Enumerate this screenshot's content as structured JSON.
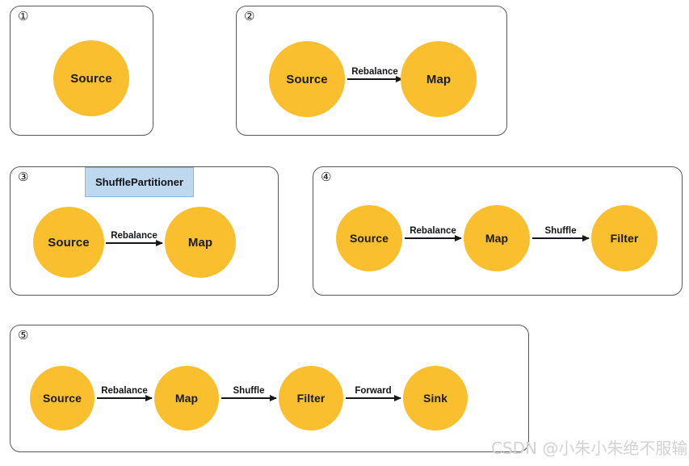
{
  "background_color": "#ffffff",
  "node_color": "#fabf2e",
  "panel_border_color": "#55595c",
  "edge_color": "#15171a",
  "callout_fill": "#bed8ef",
  "callout_border": "#8fb4d4",
  "watermark": "CSDN @小朱小朱绝不服输",
  "panels": [
    {
      "number": "①",
      "nodes": [
        {
          "label": "Source"
        }
      ],
      "edges": []
    },
    {
      "number": "②",
      "nodes": [
        {
          "label": "Source"
        },
        {
          "label": "Map"
        }
      ],
      "edges": [
        {
          "label": "Rebalance"
        }
      ]
    },
    {
      "number": "③",
      "callout": "ShufflePartitioner",
      "nodes": [
        {
          "label": "Source"
        },
        {
          "label": "Map"
        }
      ],
      "edges": [
        {
          "label": "Rebalance"
        }
      ]
    },
    {
      "number": "④",
      "nodes": [
        {
          "label": "Source"
        },
        {
          "label": "Map"
        },
        {
          "label": "Filter"
        }
      ],
      "edges": [
        {
          "label": "Rebalance"
        },
        {
          "label": "Shuffle"
        }
      ]
    },
    {
      "number": "⑤",
      "nodes": [
        {
          "label": "Source"
        },
        {
          "label": "Map"
        },
        {
          "label": "Filter"
        },
        {
          "label": "Sink"
        }
      ],
      "edges": [
        {
          "label": "Rebalance"
        },
        {
          "label": "Shuffle"
        },
        {
          "label": "Forward"
        }
      ]
    }
  ]
}
